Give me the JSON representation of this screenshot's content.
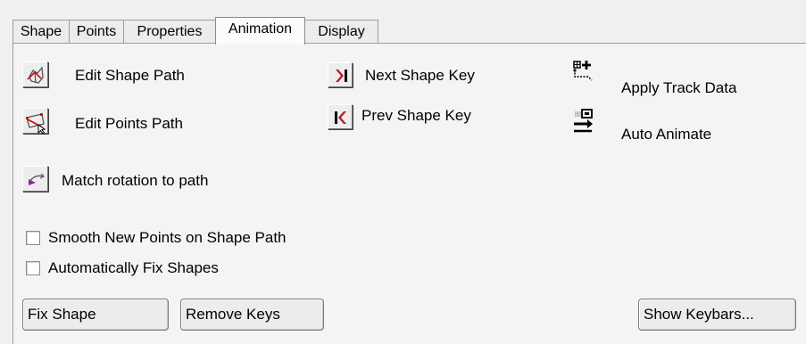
{
  "tabs": [
    {
      "label": "Shape"
    },
    {
      "label": "Points"
    },
    {
      "label": "Properties"
    },
    {
      "label": "Animation",
      "active": true
    },
    {
      "label": "Display"
    }
  ],
  "tools": {
    "edit_shape_path": "Edit Shape Path",
    "edit_points_path": "Edit Points Path",
    "next_shape_key": "Next Shape Key",
    "prev_shape_key": "Prev Shape Key",
    "apply_track_data": "Apply Track Data",
    "auto_animate": "Auto Animate",
    "match_rotation": "Match rotation to path"
  },
  "options": {
    "smooth_new_points": {
      "label": "Smooth New Points on Shape Path",
      "checked": false
    },
    "auto_fix_shapes": {
      "label": "Automatically Fix Shapes",
      "checked": false
    }
  },
  "buttons": {
    "fix_shape": "Fix Shape",
    "remove_keys": "Remove Keys",
    "show_keybars": "Show Keybars..."
  },
  "colors": {
    "accent_red": "#c0141c",
    "path_purple": "#8a2a9c",
    "panel_bg": "#f4f4f4"
  }
}
